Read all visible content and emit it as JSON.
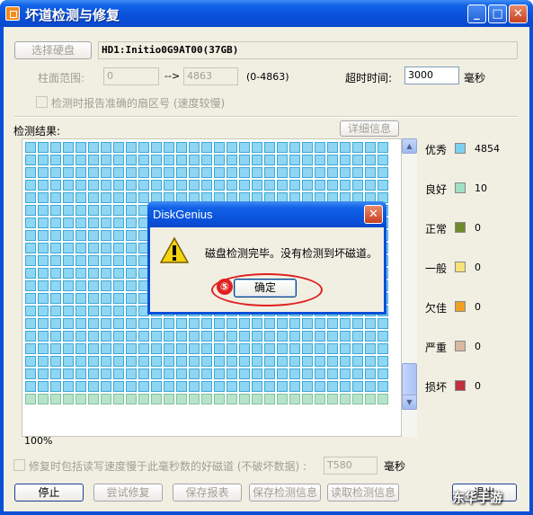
{
  "window": {
    "title": "坏道检测与修复",
    "minimize_glyph": "_",
    "maximize_glyph": "□",
    "close_glyph": "✕"
  },
  "disk": {
    "select_button": "选择硬盘",
    "name": "HD1:Initio0G9AT00(37GB)"
  },
  "range": {
    "label": "柱面范围:",
    "start": "0",
    "arrow": "-->",
    "end": "4863",
    "hint": "(0-4863)"
  },
  "timeout": {
    "label": "超时时间:",
    "value": "3000",
    "unit": "毫秒"
  },
  "accurate_check": {
    "label": "检测时报告准确的扇区号 (速度较慢)",
    "checked": false
  },
  "results": {
    "label": "检测结果:",
    "detail_button": "详细信息",
    "cell_colors": {
      "excellent": "#8fd6f2",
      "good": "#b7e4c9"
    }
  },
  "legend": [
    {
      "label": "优秀",
      "count": "4854",
      "color": "#7fd0f0"
    },
    {
      "label": "良好",
      "count": "10",
      "color": "#9ee0c4"
    },
    {
      "label": "正常",
      "count": "0",
      "color": "#6e8a2a"
    },
    {
      "label": "一般",
      "count": "0",
      "color": "#f7e27a"
    },
    {
      "label": "欠佳",
      "count": "0",
      "color": "#f0a020"
    },
    {
      "label": "严重",
      "count": "0",
      "color": "#d8b9a0"
    },
    {
      "label": "损坏",
      "count": "0",
      "color": "#c0303a"
    }
  ],
  "progress_text": "100%",
  "repair_option": {
    "label": "修复时包括读写速度慢于此毫秒数的好磁道 (不破坏数据) :",
    "value": "T580",
    "unit": "毫秒",
    "checked": false
  },
  "buttons": {
    "stop": "停止",
    "try_repair": "尝试修复",
    "save_report": "保存报表",
    "save_info": "保存检测信息",
    "read_info": "读取检测信息",
    "exit": "退出"
  },
  "dialog": {
    "title": "DiskGenius",
    "message": "磁盘检测完毕。没有检测到坏磁道。",
    "ok": "确定",
    "close_glyph": "✕",
    "step_marker": "⑤"
  },
  "watermark": "东华手游"
}
